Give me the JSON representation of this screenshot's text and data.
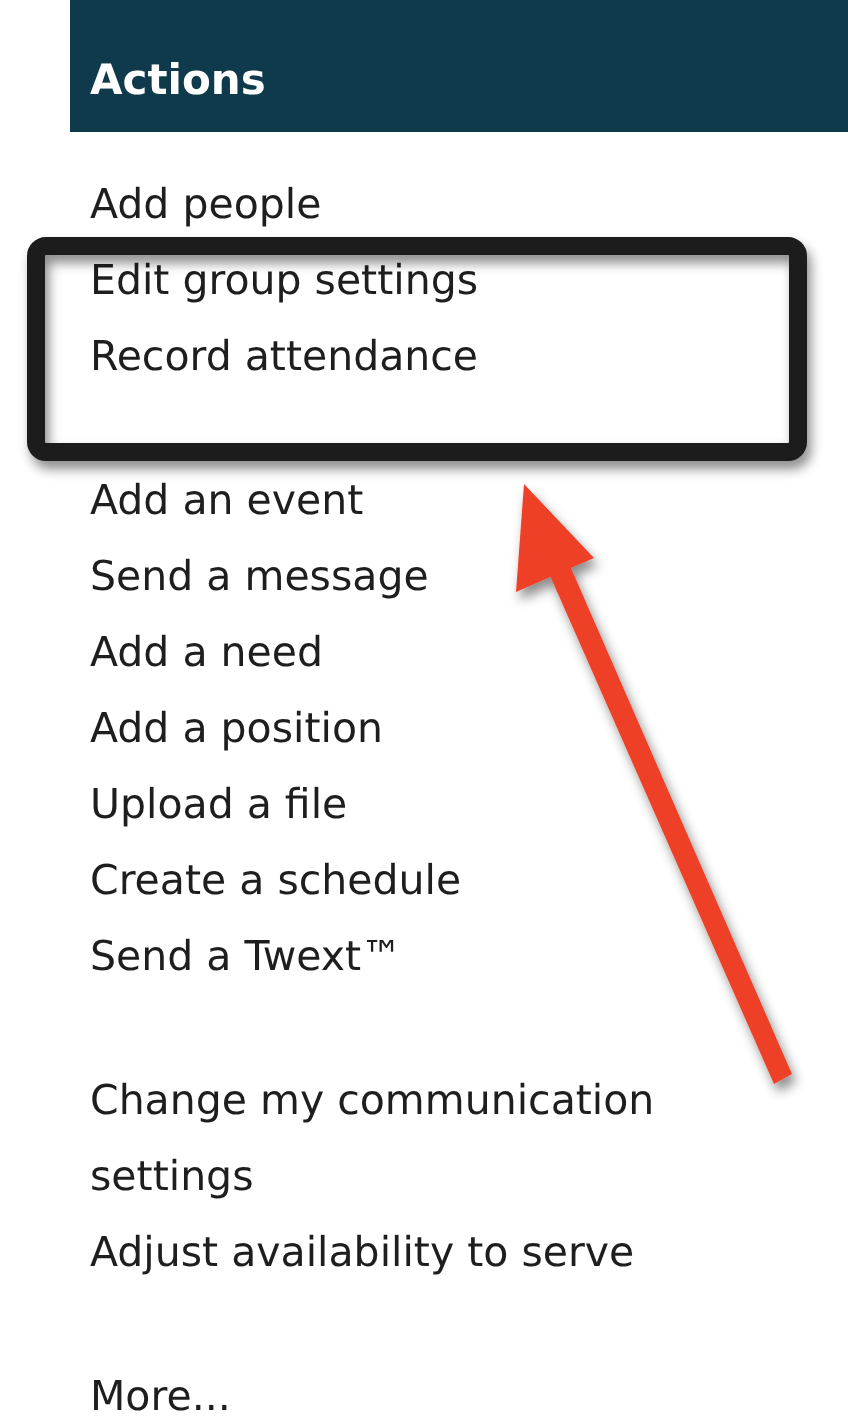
{
  "header": {
    "title": "Actions"
  },
  "groups": [
    {
      "links": [
        "Add people",
        "Edit group settings",
        "Record attendance"
      ]
    },
    {
      "links": [
        "Add an event",
        "Send a message",
        "Add a need",
        "Add a position",
        "Upload a file",
        "Create a schedule",
        "Send a Twext™"
      ]
    },
    {
      "links": [
        "Change my communication settings",
        "Adjust availability to serve"
      ]
    },
    {
      "links": [
        "More..."
      ]
    }
  ]
}
